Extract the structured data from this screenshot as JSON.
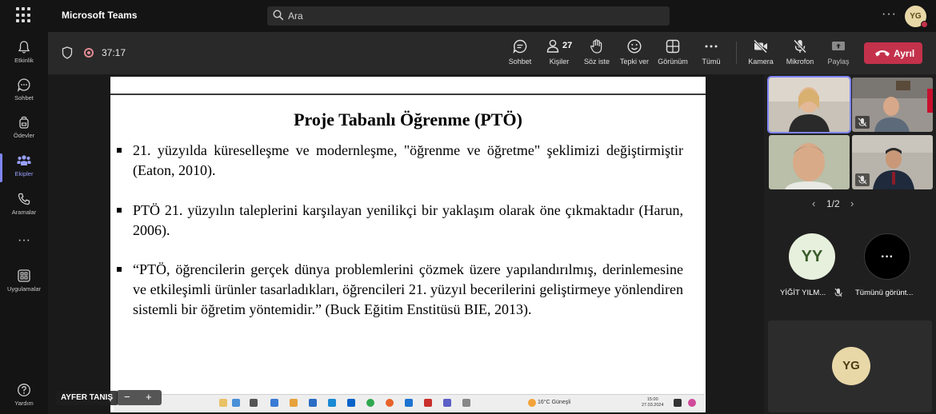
{
  "app": {
    "title": "Microsoft Teams",
    "user_initials": "YG"
  },
  "search": {
    "placeholder": "Ara"
  },
  "rail": {
    "items": [
      {
        "label": "Etkinlik",
        "icon": "bell-icon"
      },
      {
        "label": "Sohbet",
        "icon": "chat-icon"
      },
      {
        "label": "Ödevler",
        "icon": "backpack-icon"
      },
      {
        "label": "Ekipler",
        "icon": "teams-icon",
        "active": true
      },
      {
        "label": "Aramalar",
        "icon": "phone-icon"
      },
      {
        "label": "Uygulamalar",
        "icon": "apps-icon"
      },
      {
        "label": "Yardım",
        "icon": "help-icon"
      }
    ]
  },
  "meeting": {
    "timer": "37:17",
    "people_count": "27",
    "toolbar": {
      "chat": "Sohbet",
      "people": "Kişiler",
      "raise": "Söz iste",
      "react": "Tepki ver",
      "view": "Görünüm",
      "more": "Tümü",
      "camera": "Kamera",
      "mic": "Mikrofon",
      "share": "Paylaş",
      "leave": "Ayrıl"
    }
  },
  "slide": {
    "title": "Proje Tabanlı Öğrenme (PTÖ)",
    "bullets": [
      "21. yüzyılda küreselleşme ve modernleşme, \"öğrenme ve öğretme\" şeklimizi değiştirmiştir (Eaton, 2010).",
      "PTÖ 21. yüzyılın taleplerini karşılayan yenilikçi bir yaklaşım olarak öne çıkmaktadır (Harun, 2006).",
      "“PTÖ, öğrencilerin gerçek dünya problemlerini çözmek üzere yapılandırılmış, derinlemesine ve etkileşimli ürünler tasarladıkları, öğrencileri 21. yüzyıl becerilerini geliştirmeye yönlendiren sistemli bir öğretim yöntemidir.” (Buck Eğitim Enstitüsü BIE, 2013)."
    ],
    "presenter": "AYFER TANIŞ",
    "taskbar_weather": "16°C Güneşli",
    "taskbar_time": "15:00",
    "taskbar_date": "27.03.2024"
  },
  "participants": {
    "pager": "1/2",
    "yy": {
      "initials": "YY",
      "name": "YİĞİT YILM..."
    },
    "more": {
      "label": "Tümünü görünt..."
    },
    "self_initials": "YG"
  },
  "colors": {
    "accent": "#7f85f5",
    "leave": "#c4314b"
  }
}
